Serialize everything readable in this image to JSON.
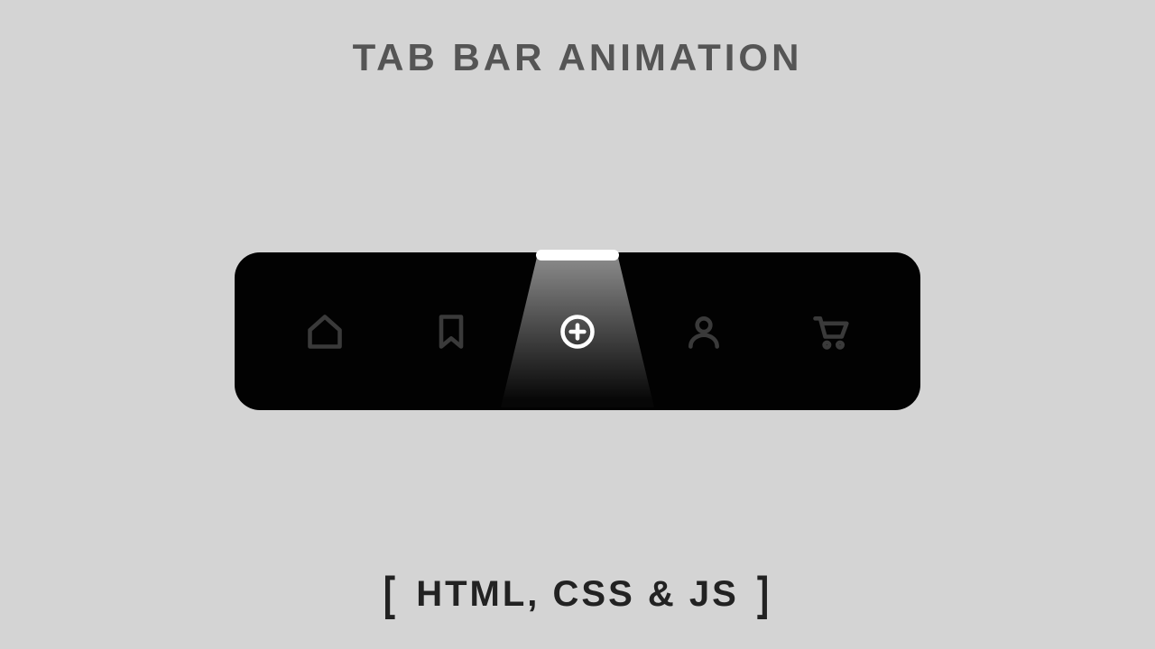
{
  "title": "TAB BAR  ANIMATION",
  "subtitle": {
    "open_bracket": "[",
    "text": "HTML, CSS & JS",
    "close_bracket": "]"
  },
  "tabbar": {
    "active_index": 2,
    "items": [
      {
        "name": "home",
        "icon": "home-icon"
      },
      {
        "name": "bookmark",
        "icon": "bookmark-icon"
      },
      {
        "name": "add",
        "icon": "add-circle-icon"
      },
      {
        "name": "profile",
        "icon": "user-icon"
      },
      {
        "name": "cart",
        "icon": "cart-icon"
      }
    ]
  },
  "colors": {
    "background": "#d4d4d4",
    "bar": "#020202",
    "icon_inactive": "#3a3a3a",
    "icon_active": "#ffffff",
    "title": "#555555",
    "subtitle": "#222222"
  }
}
